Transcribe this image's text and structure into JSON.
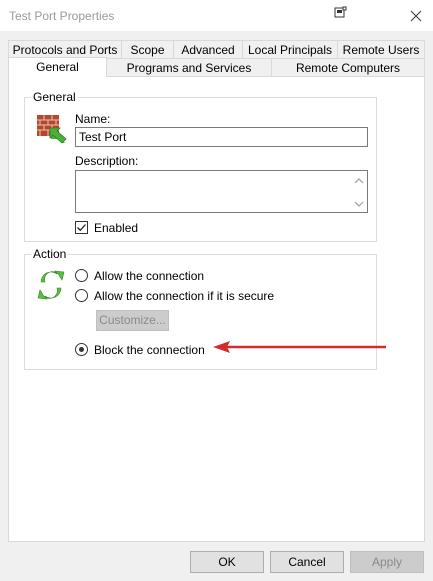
{
  "window": {
    "title": "Test Port Properties"
  },
  "tabs_row1": [
    {
      "label": "Protocols and Ports"
    },
    {
      "label": "Scope"
    },
    {
      "label": "Advanced"
    },
    {
      "label": "Local Principals"
    },
    {
      "label": "Remote Users"
    }
  ],
  "tabs_row2": [
    {
      "label": "General"
    },
    {
      "label": "Programs and Services"
    },
    {
      "label": "Remote Computers"
    }
  ],
  "general_group": {
    "title": "General",
    "name_label": "Name:",
    "name_value": "Test Port",
    "description_label": "Description:",
    "description_value": "",
    "enabled_label": "Enabled",
    "enabled_checked": true
  },
  "action_group": {
    "title": "Action",
    "options": [
      {
        "label": "Allow the connection",
        "checked": false
      },
      {
        "label": "Allow the connection if it is secure",
        "checked": false
      },
      {
        "label": "Block the connection",
        "checked": true
      }
    ],
    "customize_label": "Customize..."
  },
  "footer": {
    "ok_label": "OK",
    "cancel_label": "Cancel",
    "apply_label": "Apply"
  },
  "colors": {
    "annotation_arrow": "#d42a2a",
    "firewall_brick": "#b5482c",
    "green_arrow": "#4cae3b"
  }
}
